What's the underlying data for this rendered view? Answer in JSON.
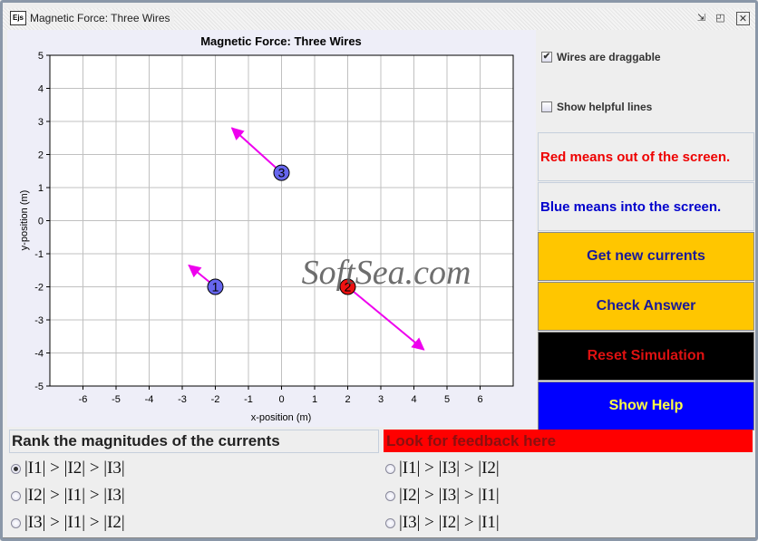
{
  "window": {
    "title": "Magnetic Force: Three Wires",
    "logo": "Ejs",
    "icons": [
      "restore-icon",
      "maximize-icon",
      "close-icon"
    ]
  },
  "plot": {
    "title": "Magnetic Force: Three Wires",
    "xlabel": "x-position (m)",
    "ylabel": "y-position (m)",
    "xlim": [
      -7,
      7
    ],
    "ylim": [
      -5,
      5
    ],
    "xticks": [
      -6,
      -5,
      -4,
      -3,
      -2,
      -1,
      0,
      1,
      2,
      3,
      4,
      5,
      6
    ],
    "yticks": [
      -5,
      -4,
      -3,
      -2,
      -1,
      0,
      1,
      2,
      3,
      4,
      5
    ],
    "grid": true,
    "wires": [
      {
        "label": "1",
        "x": -2,
        "y": -2,
        "color": "#6666ee",
        "force_tip": [
          -2.8,
          -1.35
        ]
      },
      {
        "label": "2",
        "x": 2,
        "y": -2,
        "color": "#ee1111",
        "force_tip": [
          4.3,
          -3.9
        ]
      },
      {
        "label": "3",
        "x": 0,
        "y": 1.45,
        "color": "#6666ee",
        "force_tip": [
          -1.5,
          2.8
        ]
      }
    ],
    "arrow_color": "#ee00ee",
    "watermark": "SoftSea.com"
  },
  "controls": {
    "draggable": {
      "label": "Wires are draggable",
      "checked": true
    },
    "helpful": {
      "label": "Show helpful lines",
      "checked": false
    },
    "red_note": "Red means out of the screen.",
    "blue_note": "Blue means into the screen.",
    "buttons": {
      "new": "Get new currents",
      "check": "Check Answer",
      "reset": "Reset Simulation",
      "help": "Show Help"
    }
  },
  "question": {
    "prompt": "Rank the magnitudes of the currents",
    "feedback": "Look for feedback here",
    "options": [
      "|I1| > |I2| > |I3|",
      "|I1| > |I3| > |I2|",
      "|I2| > |I1| > |I3|",
      "|I2| > |I3| > |I1|",
      "|I3| > |I1| > |I2|",
      "|I3| > |I2| > |I1|"
    ],
    "selected": 0
  }
}
